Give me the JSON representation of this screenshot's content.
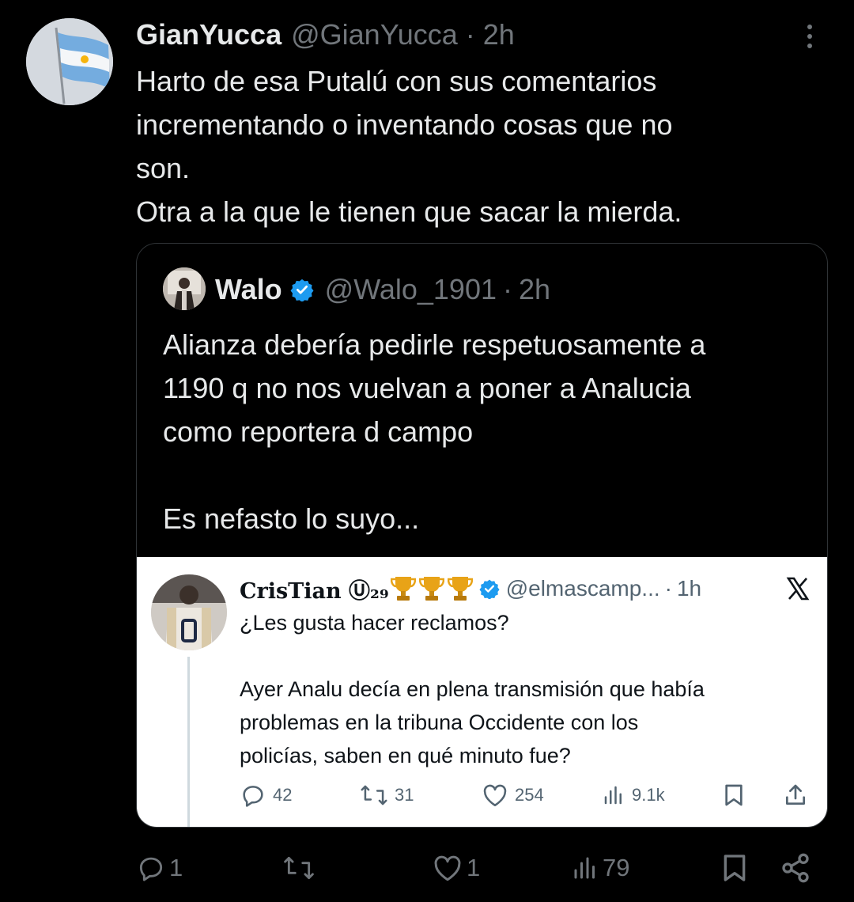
{
  "tweet": {
    "display_name": "GianYucca",
    "handle": "@GianYucca",
    "separator": "·",
    "time": "2h",
    "text_lines": [
      "Harto de esa Putalú con sus comentarios",
      "incrementando o inventando cosas que no",
      "son.",
      "Otra a la que le tienen que sacar la mierda."
    ],
    "actions": {
      "replies": "1",
      "retweets": "",
      "likes": "1",
      "views": "79"
    }
  },
  "quoted_tweet": {
    "display_name": "Walo",
    "handle": "@Walo_1901",
    "separator": "·",
    "time": "2h",
    "verified": true,
    "text_lines": [
      "Alianza debería pedirle respetuosamente a",
      "1190 q no nos vuelvan a poner a Analucia",
      "como reportera d campo"
    ],
    "text_line_2": "Es nefasto lo suyo..."
  },
  "screenshot_tweet": {
    "display_name": "CrisTian Ⓤ₂₉",
    "handle": "@elmascamp...",
    "separator": "·",
    "time": "1h",
    "verified": true,
    "text_line_1": "¿Les gusta hacer reclamos?",
    "text_lines_2": [
      "Ayer Analu decía en plena transmisión que había",
      "problemas en la tribuna Occidente con los",
      "policías, saben en qué minuto fue?"
    ],
    "actions": {
      "replies": "42",
      "retweets": "31",
      "likes": "254",
      "views": "9.1k"
    }
  },
  "colors": {
    "background": "#000000",
    "text": "#e7e9ea",
    "muted": "#71767b",
    "verified": "#1d9bf0",
    "border": "#2f3336"
  },
  "icons": [
    "more-icon",
    "verified-icon",
    "trophy-icon",
    "x-logo-icon",
    "reply-icon",
    "retweet-icon",
    "like-icon",
    "views-icon",
    "bookmark-icon",
    "share-icon"
  ]
}
